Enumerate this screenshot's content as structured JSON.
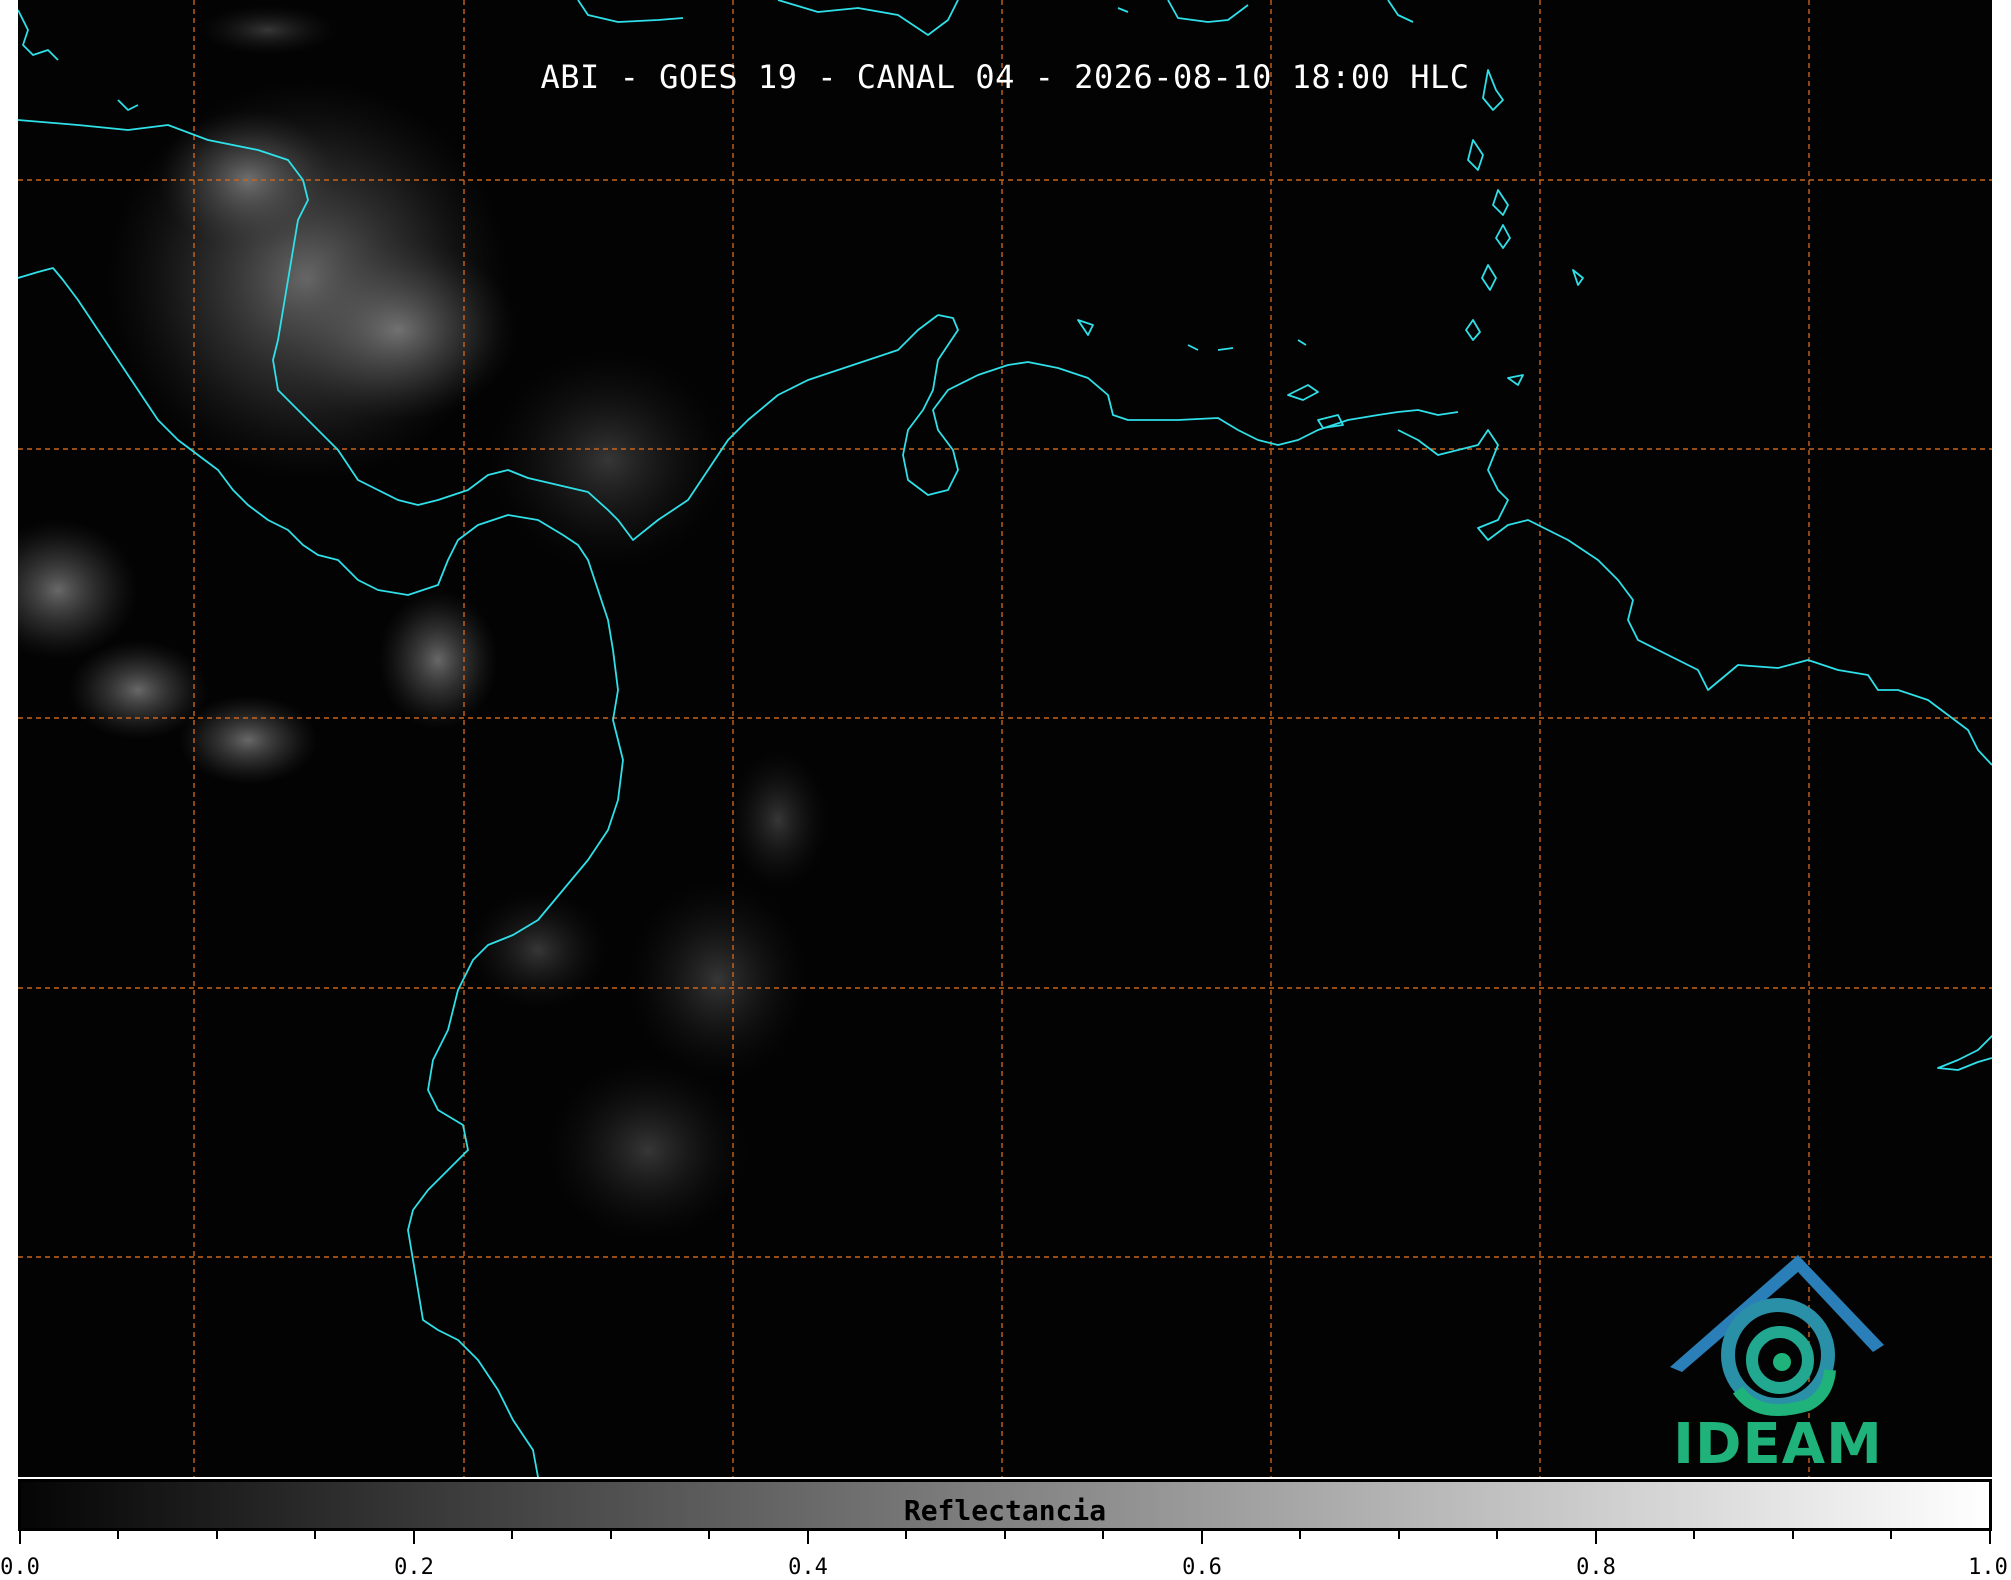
{
  "title": "ABI - GOES 19 - CANAL 04 - 2026-08-10 18:00 HLC",
  "colors": {
    "background": "#030303",
    "coastline": "#2fe0e8",
    "grid": "#c8641e",
    "logo_blue": "#2a7fb8",
    "logo_green": "#1fb27a"
  },
  "logo": {
    "text": "IDEAM"
  },
  "colorbar": {
    "label": "Reflectancia",
    "range": [
      0.0,
      1.0
    ],
    "tick_labels": [
      "0.0",
      "0.2",
      "0.4",
      "0.6",
      "0.8",
      "1.0"
    ],
    "colormap": "grayscale black-to-white"
  }
}
